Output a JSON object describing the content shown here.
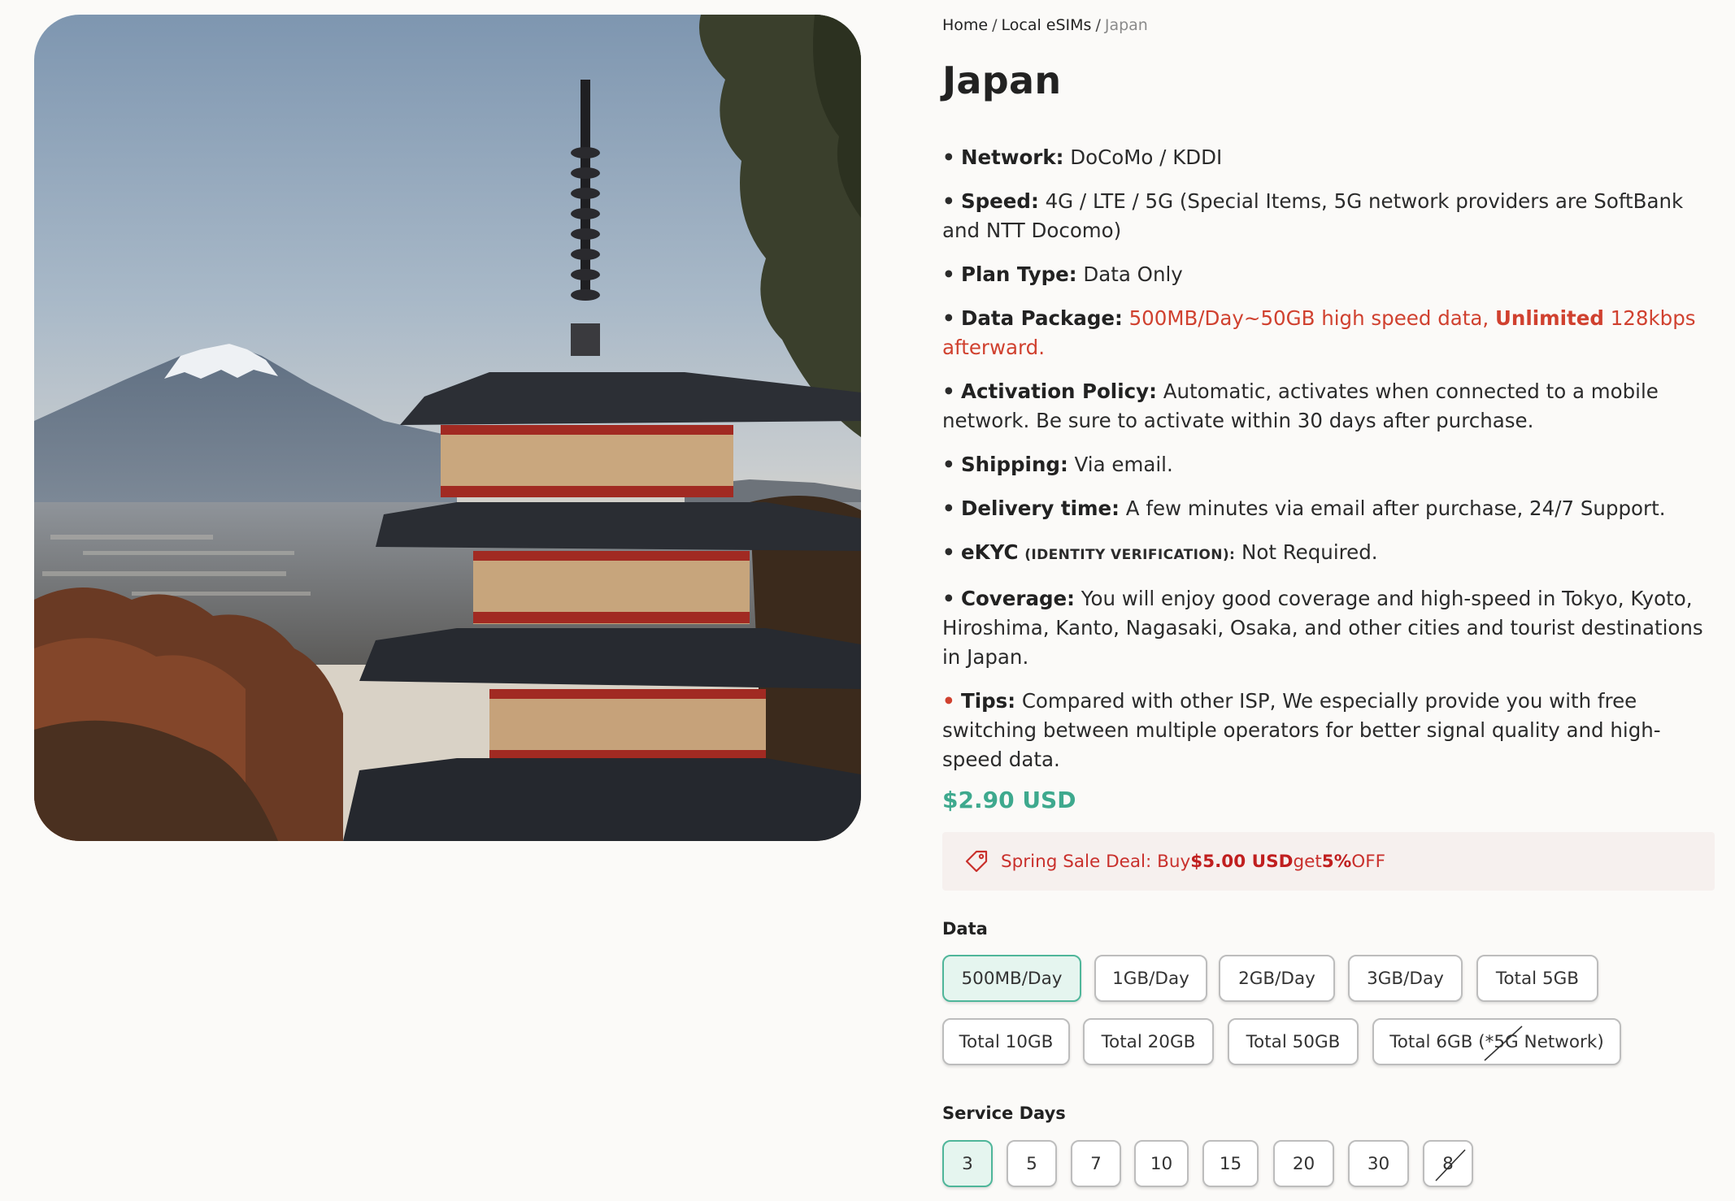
{
  "hero": {
    "alt_icon": "pagoda-mount-fuji-photo"
  },
  "breadcrumb": {
    "items": [
      "Home",
      "Local eSIMs"
    ],
    "current": "Japan"
  },
  "title": "Japan",
  "specs": [
    {
      "label": "Network:",
      "value": "DoCoMo / KDDI"
    },
    {
      "label": "Speed:",
      "value": "4G / LTE / 5G (Special Items, 5G network providers are SoftBank and NTT Docomo)"
    },
    {
      "label": "Plan Type:",
      "value": "Data Only"
    },
    {
      "label": "Data Package:",
      "value_part1": "500MB/Day~50GB high speed data, ",
      "value_bold": "Unlimited",
      "value_part2": " 128kbps afterward."
    },
    {
      "label": "Activation Policy:",
      "value": "Automatic, activates when connected to a mobile network. Be sure to activate within 30 days after purchase."
    },
    {
      "label": "Shipping:",
      "value": "Via email."
    },
    {
      "label": "Delivery time:",
      "value": "A few minutes via email after purchase, 24/7 Support."
    },
    {
      "label": "eKYC",
      "label_small": "(IDENTITY VERIFICATION):",
      "value": "Not Required."
    },
    {
      "label": "Coverage:",
      "value": "You will enjoy good coverage and high-speed in Tokyo, Kyoto, Hiroshima, Kanto, Nagasaki, Osaka, and other cities and tourist destinations in Japan."
    },
    {
      "label": "Tips:",
      "value": "Compared with other ISP, We especially provide you with free switching between multiple operators for better signal quality and high-speed data."
    }
  ],
  "price": "$2.90 USD",
  "deal": {
    "icon": "price-tag-icon",
    "prefix": "Spring Sale Deal: Buy ",
    "amount": "$5.00 USD",
    "middle": " get ",
    "percent": "5%",
    "suffix": " OFF"
  },
  "data_section": {
    "label": "Data",
    "options": [
      "500MB/Day",
      "1GB/Day",
      "2GB/Day",
      "3GB/Day",
      "Total 5GB",
      "Total 10GB",
      "Total 20GB",
      "Total 50GB",
      "Total 6GB (*5G Network)"
    ],
    "selected": "500MB/Day",
    "unavailable": [
      "Total 6GB (*5G Network)"
    ]
  },
  "days_section": {
    "label": "Service Days",
    "options": [
      "3",
      "5",
      "7",
      "10",
      "15",
      "20",
      "30",
      "8"
    ],
    "selected": "3",
    "unavailable": [
      "8"
    ]
  },
  "colors": {
    "accent_green": "#3ea98e",
    "selected_bg": "#e5f5ef",
    "highlight_red": "#d0412f",
    "deal_bg": "#f6f0ee"
  }
}
